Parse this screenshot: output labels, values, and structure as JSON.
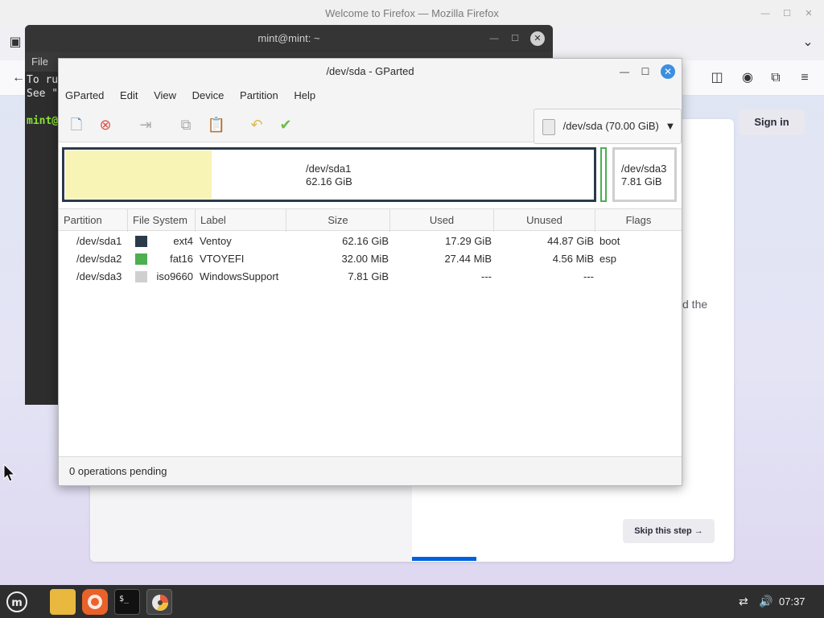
{
  "firefox": {
    "title": "Welcome to Firefox — Mozilla Firefox",
    "signin_label": "Sign in",
    "fragment_text": "d the",
    "skip_label": "Skip this step →",
    "colors": {
      "accent": "#0060df"
    }
  },
  "terminal": {
    "title": "mint@mint: ~",
    "menu_file": "File",
    "line1": "To ru",
    "line2": "See \"",
    "prompt": "mint@"
  },
  "gparted": {
    "title": "/dev/sda - GParted",
    "menu": [
      "GParted",
      "Edit",
      "View",
      "Device",
      "Partition",
      "Help"
    ],
    "device_selector": "/dev/sda (70.00 GiB)",
    "diskmap": {
      "sda1_name": "/dev/sda1",
      "sda1_size": "62.16 GiB",
      "sda3_name": "/dev/sda3",
      "sda3_size": "7.81 GiB"
    },
    "columns": [
      "Partition",
      "File System",
      "Label",
      "Size",
      "Used",
      "Unused",
      "Flags"
    ],
    "rows": [
      {
        "partition": "/dev/sda1",
        "fs": "ext4",
        "fs_color": "#2b3a4a",
        "label": "Ventoy",
        "size": "62.16 GiB",
        "used": "17.29 GiB",
        "unused": "44.87 GiB",
        "flags": "boot"
      },
      {
        "partition": "/dev/sda2",
        "fs": "fat16",
        "fs_color": "#4caf50",
        "label": "VTOYEFI",
        "size": "32.00 MiB",
        "used": "27.44 MiB",
        "unused": "4.56 MiB",
        "flags": "esp"
      },
      {
        "partition": "/dev/sda3",
        "fs": "iso9660",
        "fs_color": "#cfcfcf",
        "label": "WindowsSupport",
        "size": "7.81 GiB",
        "used": "---",
        "unused": "---",
        "flags": ""
      }
    ],
    "status": "0 operations pending",
    "toolbar_icons": [
      "new-icon",
      "delete-icon",
      "resize-move-icon",
      "copy-icon",
      "paste-icon",
      "undo-icon",
      "apply-icon"
    ]
  },
  "taskbar": {
    "clock": "07:37",
    "apps": [
      "menu-icon",
      "files-icon",
      "firefox-icon",
      "terminal-icon",
      "gparted-icon"
    ]
  }
}
